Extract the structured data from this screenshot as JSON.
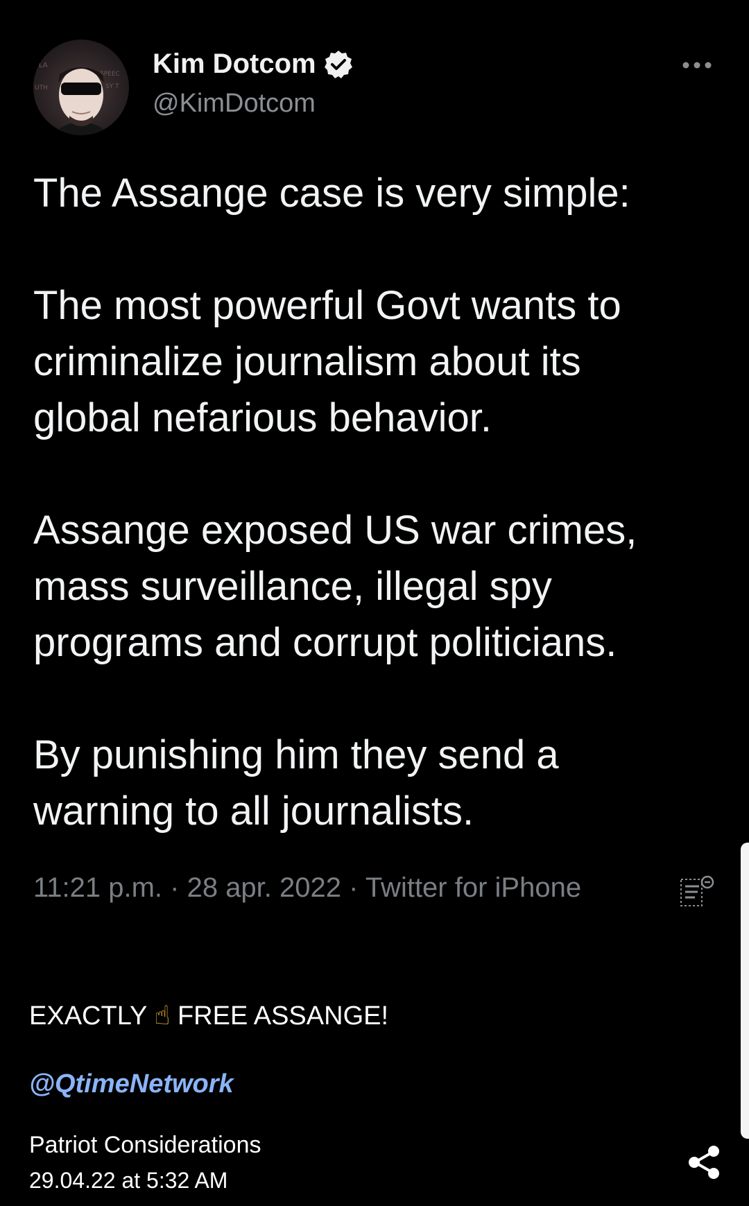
{
  "tweet": {
    "display_name": "Kim Dotcom",
    "handle": "@KimDotcom",
    "verified_icon": "verified-badge-icon",
    "more_icon": "more-dots-icon",
    "paragraphs": [
      "The Assange case is very simple:",
      "The most powerful Govt wants to\ncriminalize journalism about its\nglobal nefarious behavior.",
      "Assange exposed US war crimes,\nmass surveillance, illegal spy\nprograms and corrupt politicians.",
      "By punishing him they send a\nwarning to all journalists."
    ],
    "meta": "11:21 p.m. · 28 apr. 2022 · Twitter for iPhone",
    "translate_icon": "translate-icon"
  },
  "post": {
    "text_before_emoji": "EXACTLY",
    "emoji": "☝",
    "text_after_emoji": "FREE ASSANGE!",
    "mention": "@QtimeNetwork",
    "source_name": "Patriot Considerations",
    "source_date": "29.04.22 at 5:32 AM",
    "share_icon": "share-icon"
  },
  "colors": {
    "background": "#000000",
    "tweet_text": "#f2f3f4",
    "muted_text": "#7a7f84",
    "mention": "#8ab4f8",
    "emoji": "#f2b233"
  }
}
